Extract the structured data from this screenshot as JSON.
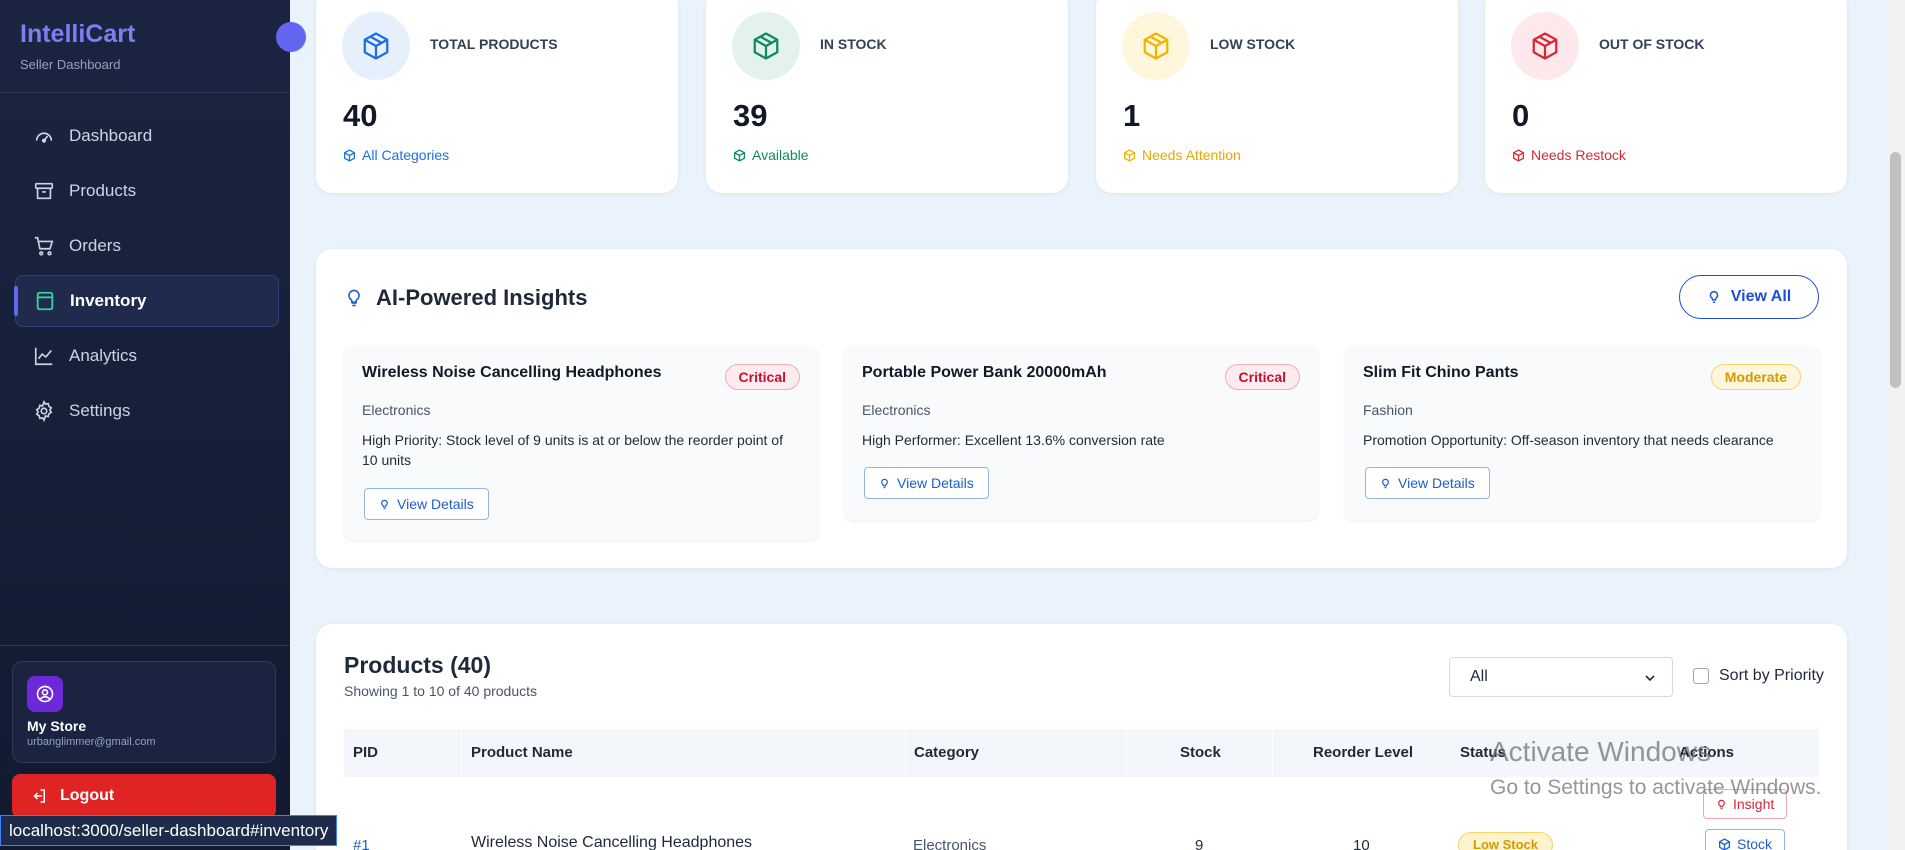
{
  "sidebar": {
    "brand": "IntelliCart",
    "subtitle": "Seller Dashboard",
    "items": [
      {
        "label": "Dashboard",
        "icon": "gauge-icon"
      },
      {
        "label": "Products",
        "icon": "archive-icon"
      },
      {
        "label": "Orders",
        "icon": "cart-icon"
      },
      {
        "label": "Inventory",
        "icon": "clipboard-icon",
        "active": true
      },
      {
        "label": "Analytics",
        "icon": "chart-line-icon"
      },
      {
        "label": "Settings",
        "icon": "gear-icon"
      }
    ],
    "store": {
      "name": "My Store",
      "email": "urbanglimmer@gmail.com"
    },
    "logout": "Logout"
  },
  "stats": [
    {
      "label": "TOTAL PRODUCTS",
      "value": "40",
      "sub": "All Categories",
      "color": "#1d6fe0",
      "bg": "#e6f0fd"
    },
    {
      "label": "IN STOCK",
      "value": "39",
      "sub": "Available",
      "color": "#0f8a5f",
      "bg": "#e3f3ec"
    },
    {
      "label": "LOW STOCK",
      "value": "1",
      "sub": "Needs Attention",
      "color": "#f0b400",
      "bg": "#fff6dc"
    },
    {
      "label": "OUT OF STOCK",
      "value": "0",
      "sub": "Needs Restock",
      "color": "#d62839",
      "bg": "#fde9ec"
    }
  ],
  "insights": {
    "title": "AI-Powered Insights",
    "view_all": "View All",
    "cards": [
      {
        "title": "Wireless Noise Cancelling Headphones",
        "badge": "Critical",
        "category": "Electronics",
        "description": "High Priority: Stock level of 9 units is at or below the reorder point of 10 units",
        "button": "View Details"
      },
      {
        "title": "Portable Power Bank 20000mAh",
        "badge": "Critical",
        "category": "Electronics",
        "description": "High Performer: Excellent 13.6% conversion rate",
        "button": "View Details"
      },
      {
        "title": "Slim Fit Chino Pants",
        "badge": "Moderate",
        "category": "Fashion",
        "description": "Promotion Opportunity: Off-season inventory that needs clearance",
        "button": "View Details"
      }
    ]
  },
  "products": {
    "title": "Products (40)",
    "subtitle": "Showing 1 to 10 of 40 products",
    "filter": "All",
    "sort_label": "Sort by Priority",
    "columns": [
      "PID",
      "Product Name",
      "Category",
      "Stock",
      "Reorder Level",
      "Status",
      "Actions"
    ],
    "row": {
      "pid": "#1",
      "name": "Wireless Noise Cancelling Headphones",
      "category": "Electronics",
      "stock": "9",
      "reorder": "10",
      "status": "Low Stock",
      "insight_btn": "Insight",
      "stock_btn": "Stock"
    }
  },
  "browser": {
    "status_url": "localhost:3000/seller-dashboard#inventory"
  },
  "watermark": {
    "title": "Activate Windows",
    "subtitle": "Go to Settings to activate Windows."
  }
}
